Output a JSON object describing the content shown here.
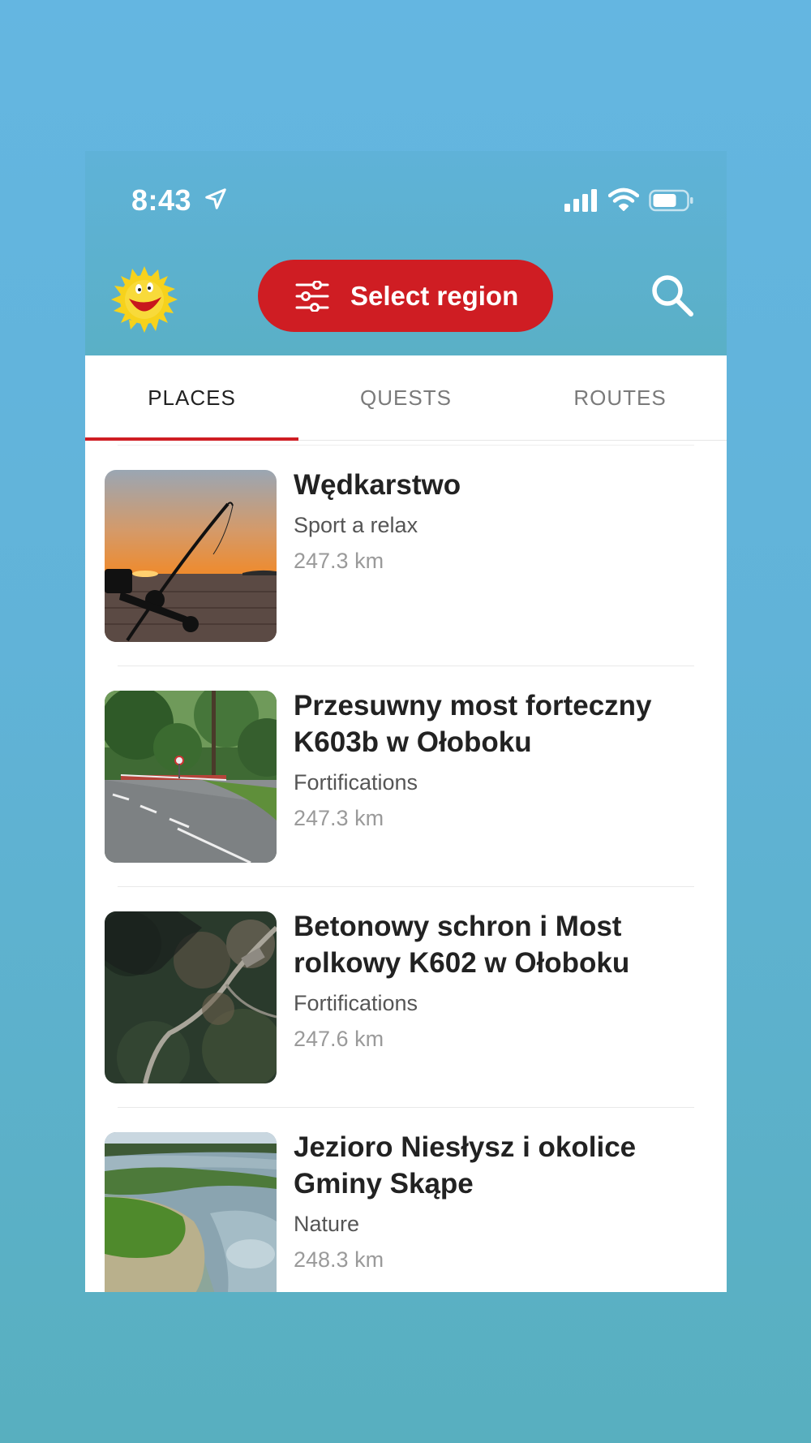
{
  "status_bar": {
    "time": "8:43"
  },
  "header": {
    "select_region_label": "Select region"
  },
  "tabs": [
    {
      "label": "PLACES",
      "active": true
    },
    {
      "label": "QUESTS",
      "active": false
    },
    {
      "label": "ROUTES",
      "active": false
    }
  ],
  "places": [
    {
      "title": "Wędkarstwo",
      "category": "Sport a relax",
      "distance": "247.3 km"
    },
    {
      "title": "Przesuwny most forteczny K603b w Ołoboku",
      "category": "Fortifications",
      "distance": "247.3 km"
    },
    {
      "title": "Betonowy schron i Most rolkowy K602 w Ołoboku",
      "category": "Fortifications",
      "distance": "247.6 km"
    },
    {
      "title": "Jezioro Niesłysz i okolice Gminy Skąpe",
      "category": "Nature",
      "distance": "248.3 km"
    }
  ],
  "colors": {
    "accent": "#cf1d23",
    "header_bg": "#5fb2d8",
    "page_bg": "#61b3d8"
  }
}
